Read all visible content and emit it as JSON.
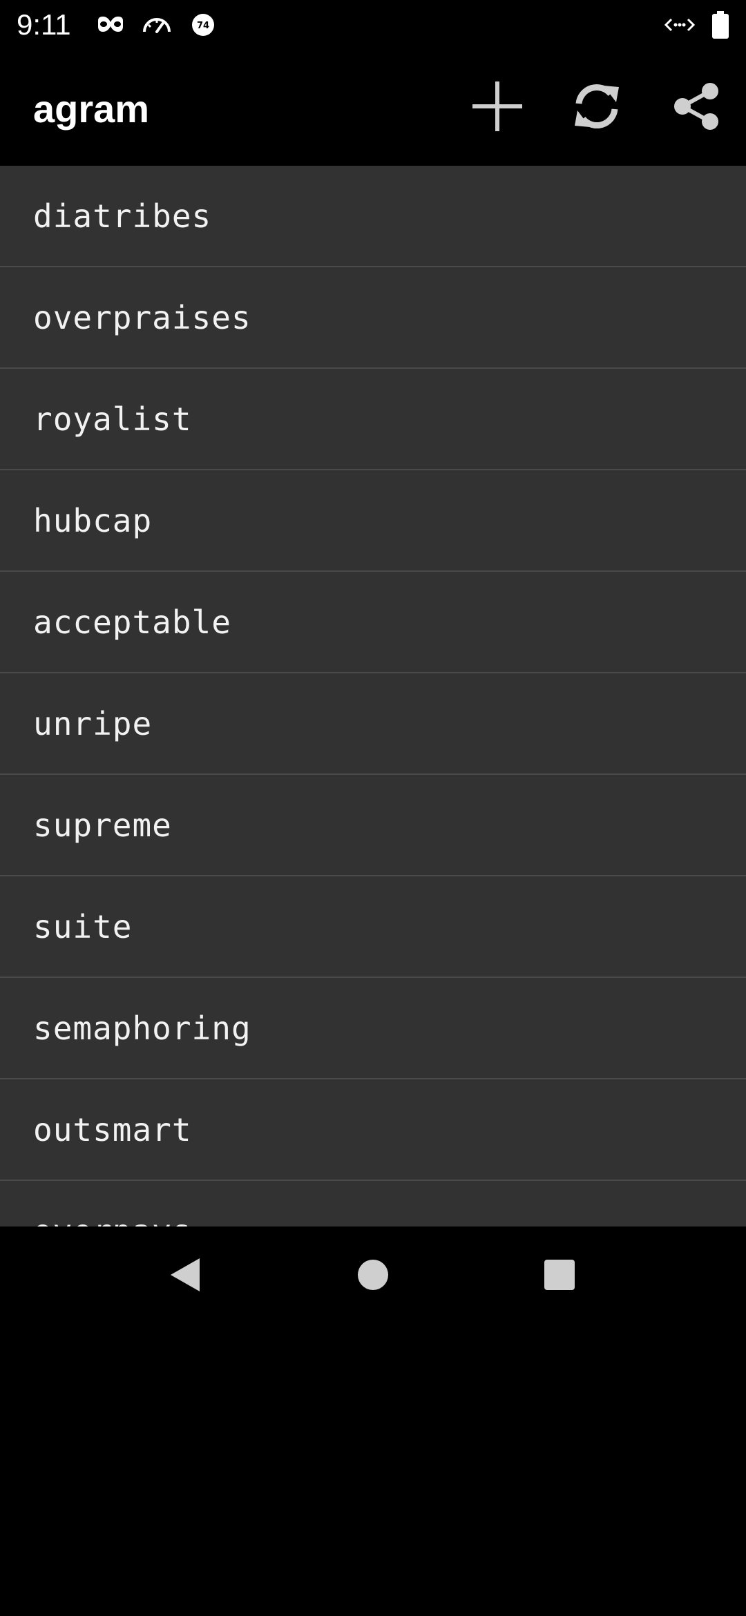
{
  "status_bar": {
    "time": "9:11",
    "badge_number": "74"
  },
  "app_bar": {
    "title": "agram"
  },
  "words": [
    "diatribes",
    "overpraises",
    "royalist",
    "hubcap",
    "acceptable",
    "unripe",
    "supreme",
    "suite",
    "semaphoring",
    "outsmart",
    "overpays"
  ],
  "colors": {
    "background": "#000000",
    "list_background": "#323232",
    "divider": "#4a4a4a",
    "text": "#f2f2f2",
    "icon": "#cfcfcf"
  }
}
